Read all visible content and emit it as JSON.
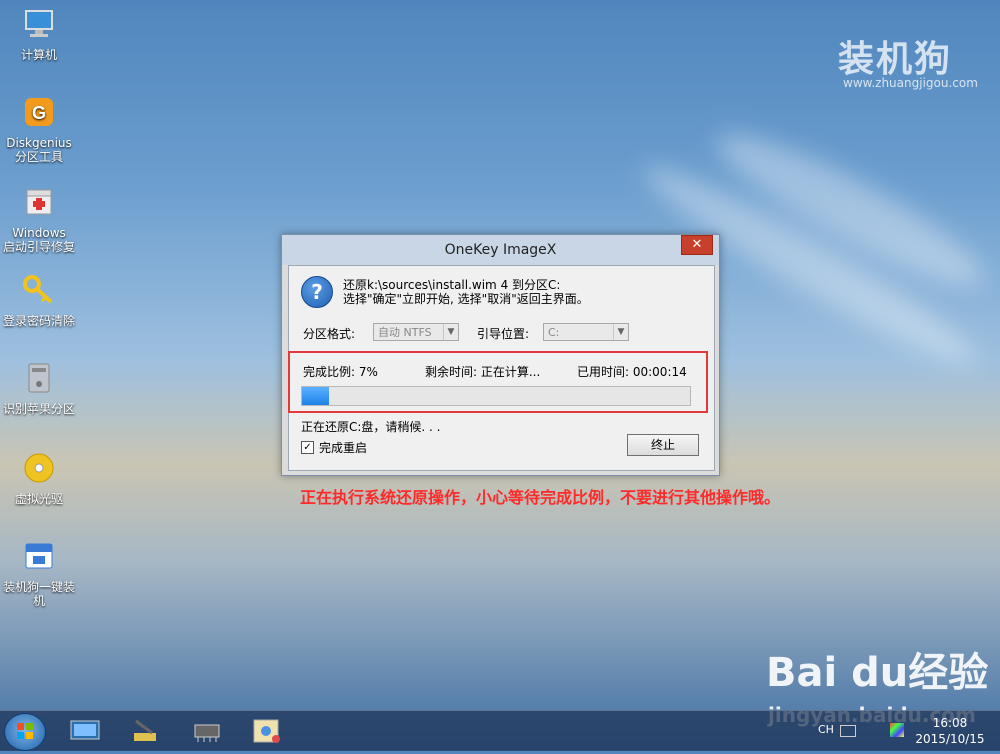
{
  "desktop_icons": [
    {
      "name": "computer-icon",
      "label": "计算机"
    },
    {
      "name": "diskgenius-icon",
      "label": "Diskgenius\n分区工具"
    },
    {
      "name": "windows-boot-repair-icon",
      "label": "Windows\n启动引导修复"
    },
    {
      "name": "password-remove-key-icon",
      "label": "登录密码清除"
    },
    {
      "name": "apple-partition-icon",
      "label": "识别苹果分区"
    },
    {
      "name": "virtual-drive-icon",
      "label": "虚拟光驱"
    },
    {
      "name": "zhuangjigou-install-icon",
      "label": "装机狗一键装\n机"
    }
  ],
  "watermark": {
    "brand": "装机狗",
    "url": "www.zhuangjigou.com"
  },
  "dialog": {
    "title": "OneKey ImageX",
    "close_label": "✕",
    "message_line1": "还原k:\\sources\\install.wim 4 到分区C:",
    "message_line2": "选择\"确定\"立即开始, 选择\"取消\"返回主界面。",
    "partition_format_label": "分区格式:",
    "partition_format_value": "自动 NTFS",
    "boot_location_label": "引导位置:",
    "boot_location_value": "C:",
    "complete_ratio": "完成比例: 7%",
    "remaining_time": "剩余时间: 正在计算...",
    "elapsed_time": "已用时间: 00:00:14",
    "progress_fraction": 0.07,
    "status": "正在还原C:盘，请稍候. . .",
    "reboot_label": "完成重启",
    "reboot_checked": "✓",
    "stop_label": "终止"
  },
  "annotation": "正在执行系统还原操作，小心等待完成比例，不要进行其他操作哦。",
  "baidu": {
    "logo": "Bai du经验",
    "url": "jingyan.baidu.com"
  },
  "taskbar": {
    "apps": [
      "screen-icon",
      "paint-icon",
      "chip-icon",
      "map-tool-icon"
    ],
    "tray_lang": "CH",
    "time": "16:08",
    "date": "2015/10/15"
  },
  "colors": {
    "accent_red": "#e03a3a",
    "progress": "#1e82e8",
    "close": "#c7402b"
  }
}
